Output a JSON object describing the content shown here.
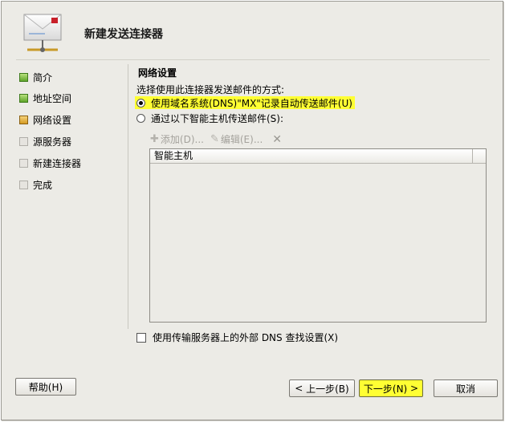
{
  "page": {
    "title": "新建发送连接器"
  },
  "sidebar": {
    "items": [
      {
        "label": "简介",
        "status": "done"
      },
      {
        "label": "地址空间",
        "status": "done"
      },
      {
        "label": "网络设置",
        "status": "current"
      },
      {
        "label": "源服务器",
        "status": "todo"
      },
      {
        "label": "新建连接器",
        "status": "todo"
      },
      {
        "label": "完成",
        "status": "todo"
      }
    ]
  },
  "main": {
    "section_title": "网络设置",
    "prompt": "选择使用此连接器发送邮件的方式:",
    "options": [
      {
        "label": "使用域名系统(DNS)\"MX\"记录自动传送邮件(U)",
        "checked": true
      },
      {
        "label": "通过以下智能主机传送邮件(S):",
        "checked": false
      }
    ],
    "toolbar": {
      "add_label": "添加(D)...",
      "edit_label": "编辑(E)...",
      "remove_icon": "delete-x-icon"
    },
    "list": {
      "columns": [
        "智能主机"
      ],
      "rows": []
    },
    "dns_checkbox": {
      "label": "使用传输服务器上的外部 DNS 查找设置(X)",
      "checked": false
    }
  },
  "footer": {
    "help_label": "帮助(H)",
    "back_label": "上一步(B)",
    "next_label": "下一步(N)",
    "cancel_label": "取消"
  },
  "colors": {
    "highlight": "#ffff33",
    "step_done": "#5fa52a",
    "step_current": "#d49a22",
    "window_bg": "#ecebe6"
  }
}
